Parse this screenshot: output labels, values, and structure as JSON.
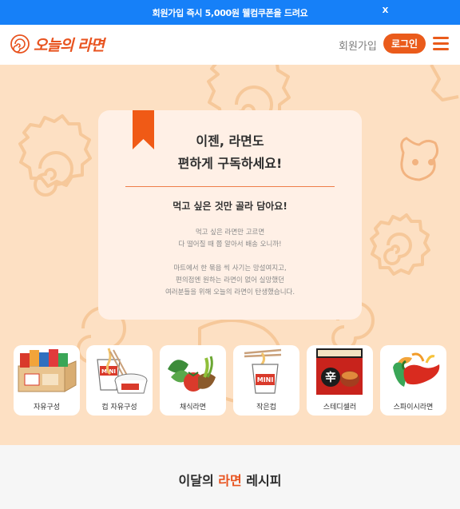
{
  "promo": {
    "text": "회원가입 즉시 5,000원 웰컴쿠폰을 드려요",
    "close": "X"
  },
  "header": {
    "logo_text": "오늘의 라면",
    "signup": "회원가입",
    "login": "로그인"
  },
  "hero": {
    "title_line1": "이젠, 라면도",
    "title_line2": "편하게 구독하세요!",
    "subtitle": "먹고 싶은 것만 골라 담아요!",
    "para1_line1": "먹고 싶은 라면만 고르면",
    "para1_line2": "다 떨어질 때 쯤 알아서 배송 오니까!",
    "para2_line1": "마트에서 한 묶음 씩 사기는 망설여지고,",
    "para2_line2": "편의점엔 원하는 라면이 없어 실망했던",
    "para2_line3": "여러분들을 위해 오늘의 라면이 탄생했습니다."
  },
  "categories": [
    {
      "label": "자유구성",
      "icon": "ramen-box-icon"
    },
    {
      "label": "컵 자유구성",
      "icon": "cup-noodle-icon"
    },
    {
      "label": "채식라면",
      "icon": "vegetables-icon"
    },
    {
      "label": "작은컵",
      "icon": "mini-cup-icon"
    },
    {
      "label": "스테디셀러",
      "icon": "shin-ramyun-icon"
    },
    {
      "label": "스파이시라면",
      "icon": "chili-pepper-icon"
    }
  ],
  "recipe": {
    "title_pre": "이달의 ",
    "title_accent": "라면",
    "title_post": " 레시피"
  },
  "colors": {
    "promo": "#1680f8",
    "accent": "#ea5b1b",
    "hero_bg": "#fde0c3",
    "card_bg": "#fff0e6"
  }
}
